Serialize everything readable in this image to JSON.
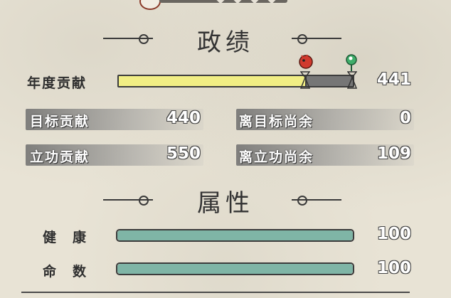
{
  "achievements": {
    "section_title": "政绩",
    "annual_contribution": {
      "label": "年度贡献",
      "value": "441",
      "progress": 0.78
    },
    "target_contribution": {
      "label": "目标贡献",
      "value": "440"
    },
    "remaining_to_target": {
      "label": "离目标尚余",
      "value": "0"
    },
    "merit_contribution": {
      "label": "立功贡献",
      "value": "550"
    },
    "remaining_to_merit": {
      "label": "离立功尚余",
      "value": "109"
    }
  },
  "attributes": {
    "section_title": "属性",
    "health": {
      "label": "健　康",
      "value": "100",
      "progress": 1.0
    },
    "lifespan": {
      "label": "命　数",
      "value": "100",
      "progress": 1.0
    }
  },
  "colors": {
    "annual_bar": "#f1ee84",
    "remaining_bar": "#767676",
    "attribute_bar": "#7fb5a6",
    "target_marker": "#d03a2e",
    "merit_marker": "#3fae6a"
  }
}
